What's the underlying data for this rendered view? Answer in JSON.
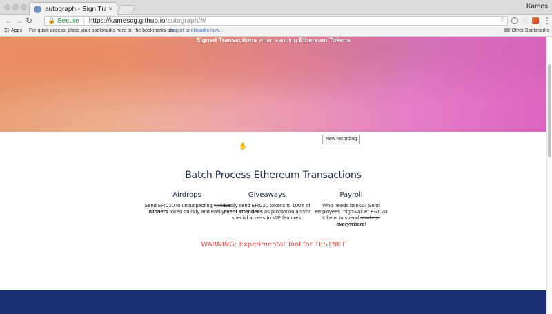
{
  "browser": {
    "tab_title": "autograph - Sign Transactions",
    "tab_close": "×",
    "profile_name": "Kames",
    "omnibox": {
      "secure_label": "Secure",
      "url_host": "https://kamescg.github.io",
      "url_path": "/autograph/#/"
    },
    "bookmarks": {
      "apps_label": "Apps",
      "hint": "For quick access, place your bookmarks here on the bookmarks bar.",
      "import_link": "Import bookmarks now...",
      "other_label": "Other Bookmarks"
    }
  },
  "hero": {
    "subtitle_part1": "Signed Transactions",
    "subtitle_part2": " when sending ",
    "subtitle_part3": "Ethereum Tokens"
  },
  "tooltip": "New recording",
  "main": {
    "title": "Batch Process Ethereum Transactions",
    "features": [
      {
        "title": "Airdrops",
        "t1": "Send ERC20 to unsuspecting ",
        "strike": "victims",
        "t2": "",
        "bold": "winners",
        "t3": " token quickly and easily."
      },
      {
        "title": "Giveaways",
        "t1": "Easily send ERC20 tokens to 100's of ",
        "bold": "event attendees",
        "t2": " as promotion and/or special access to VIP features."
      },
      {
        "title": "Payroll",
        "t1": "Who needs banks? Send employees \"high-value\" ERC20 tokens to spend ",
        "strike": "nowhere",
        "t2": " ",
        "bold": "everywhere",
        "t3": "!"
      }
    ],
    "warning": "WARNING: Experimental Tool for TESTNET"
  },
  "colors": {
    "warning": "#e0473e",
    "footer_band": "#1b2f75",
    "title": "#1c2a44"
  },
  "icons": [
    "close-icon",
    "back-arrow-icon",
    "forward-arrow-icon",
    "reload-icon",
    "lock-icon",
    "star-icon",
    "apps-grid-icon",
    "folder-icon",
    "hand-cursor-icon"
  ]
}
